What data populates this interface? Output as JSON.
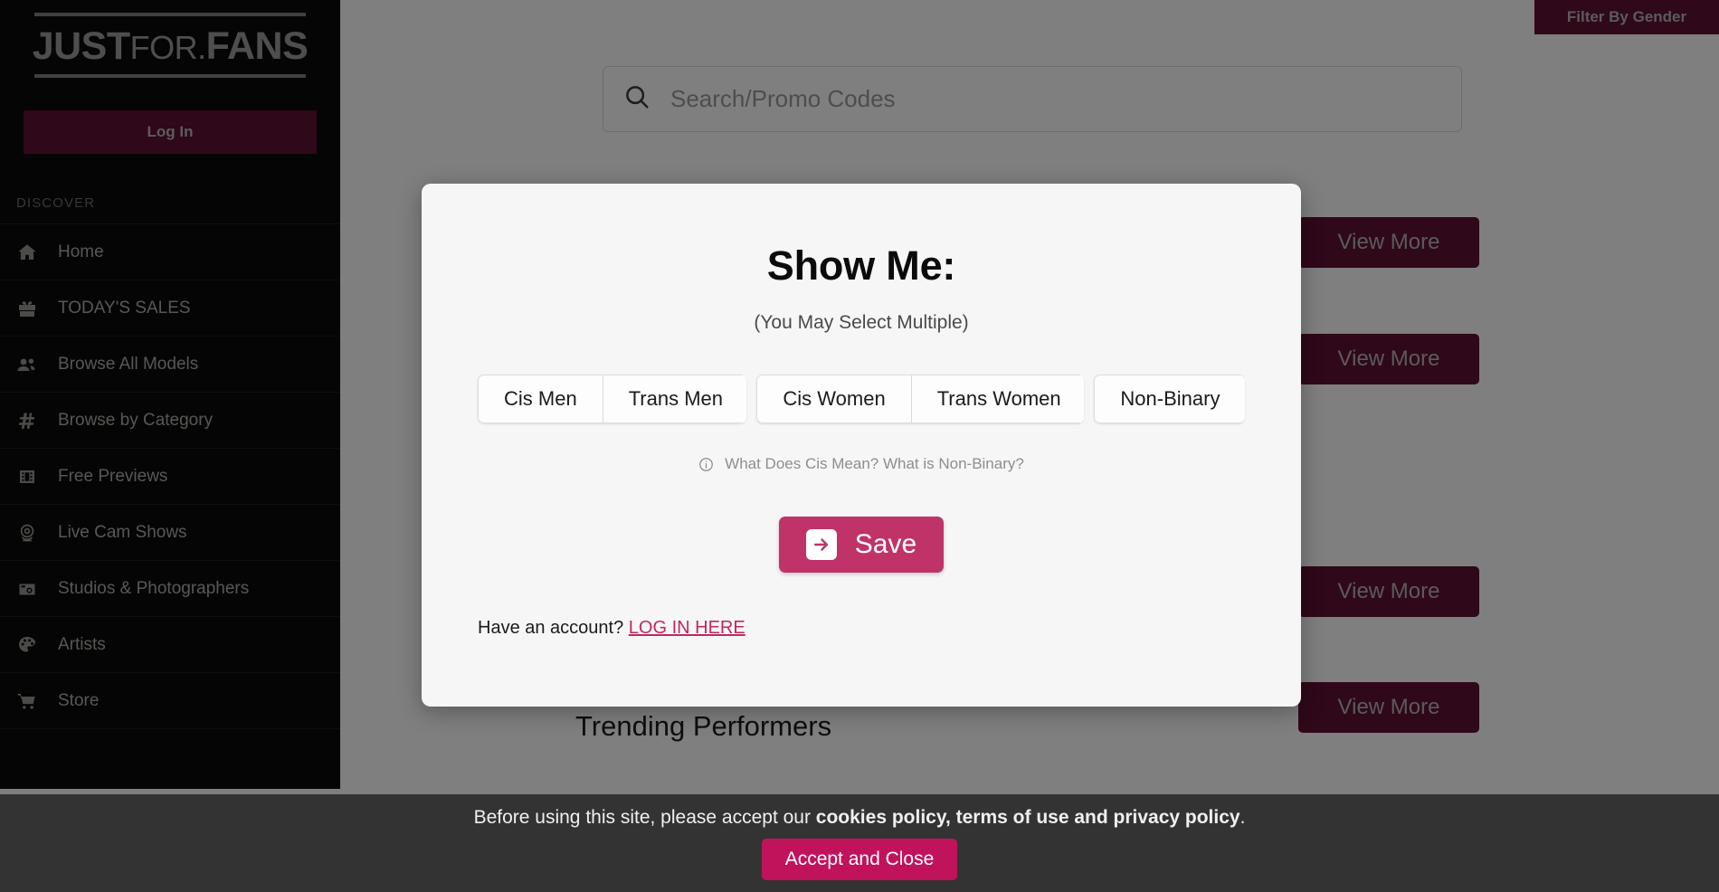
{
  "brand": {
    "logo_part1": "JUST",
    "logo_part2": "FOR.",
    "logo_part3": "FANS",
    "login_label": "Log In",
    "accent_primary": "#5e1034",
    "accent_magenta": "#c03369",
    "accent_cookie": "#c1135c"
  },
  "sidebar": {
    "section_label": "DISCOVER",
    "items": [
      {
        "label": "Home",
        "icon": "home-icon"
      },
      {
        "label": "TODAY'S SALES",
        "icon": "gift-icon"
      },
      {
        "label": "Browse All Models",
        "icon": "users-icon"
      },
      {
        "label": "Browse by Category",
        "icon": "hashtag-icon"
      },
      {
        "label": "Free Previews",
        "icon": "film-icon"
      },
      {
        "label": "Live Cam Shows",
        "icon": "webcam-icon"
      },
      {
        "label": "Studios & Photographers",
        "icon": "camera-icon"
      },
      {
        "label": "Artists",
        "icon": "palette-icon"
      },
      {
        "label": "Store",
        "icon": "cart-icon"
      }
    ]
  },
  "header": {
    "filter_by_gender_label": "Filter By Gender"
  },
  "search": {
    "placeholder": "Search/Promo Codes",
    "value": "",
    "icon": "search-icon"
  },
  "main": {
    "view_more_label": "View More",
    "view_more_count": 4,
    "section_title": "Trending Performers"
  },
  "modal": {
    "title": "Show Me:",
    "subtitle": "(You May Select Multiple)",
    "options": [
      {
        "label": "Cis Men",
        "group": 0
      },
      {
        "label": "Trans Men",
        "group": 0
      },
      {
        "label": "Cis Women",
        "group": 1
      },
      {
        "label": "Trans Women",
        "group": 1
      },
      {
        "label": "Non-Binary",
        "group": 2
      }
    ],
    "info_text": "What Does Cis Mean? What is Non-Binary?",
    "info_icon": "info-circle-icon",
    "save_label": "Save",
    "save_icon": "arrow-right-icon",
    "account_prompt": "Have an account?",
    "account_link_label": "LOG IN HERE"
  },
  "cookie_banner": {
    "text_before": "Before using this site, please accept our ",
    "text_bold": "cookies policy, terms of use and privacy policy",
    "text_after": ".",
    "accept_label": "Accept and Close"
  }
}
